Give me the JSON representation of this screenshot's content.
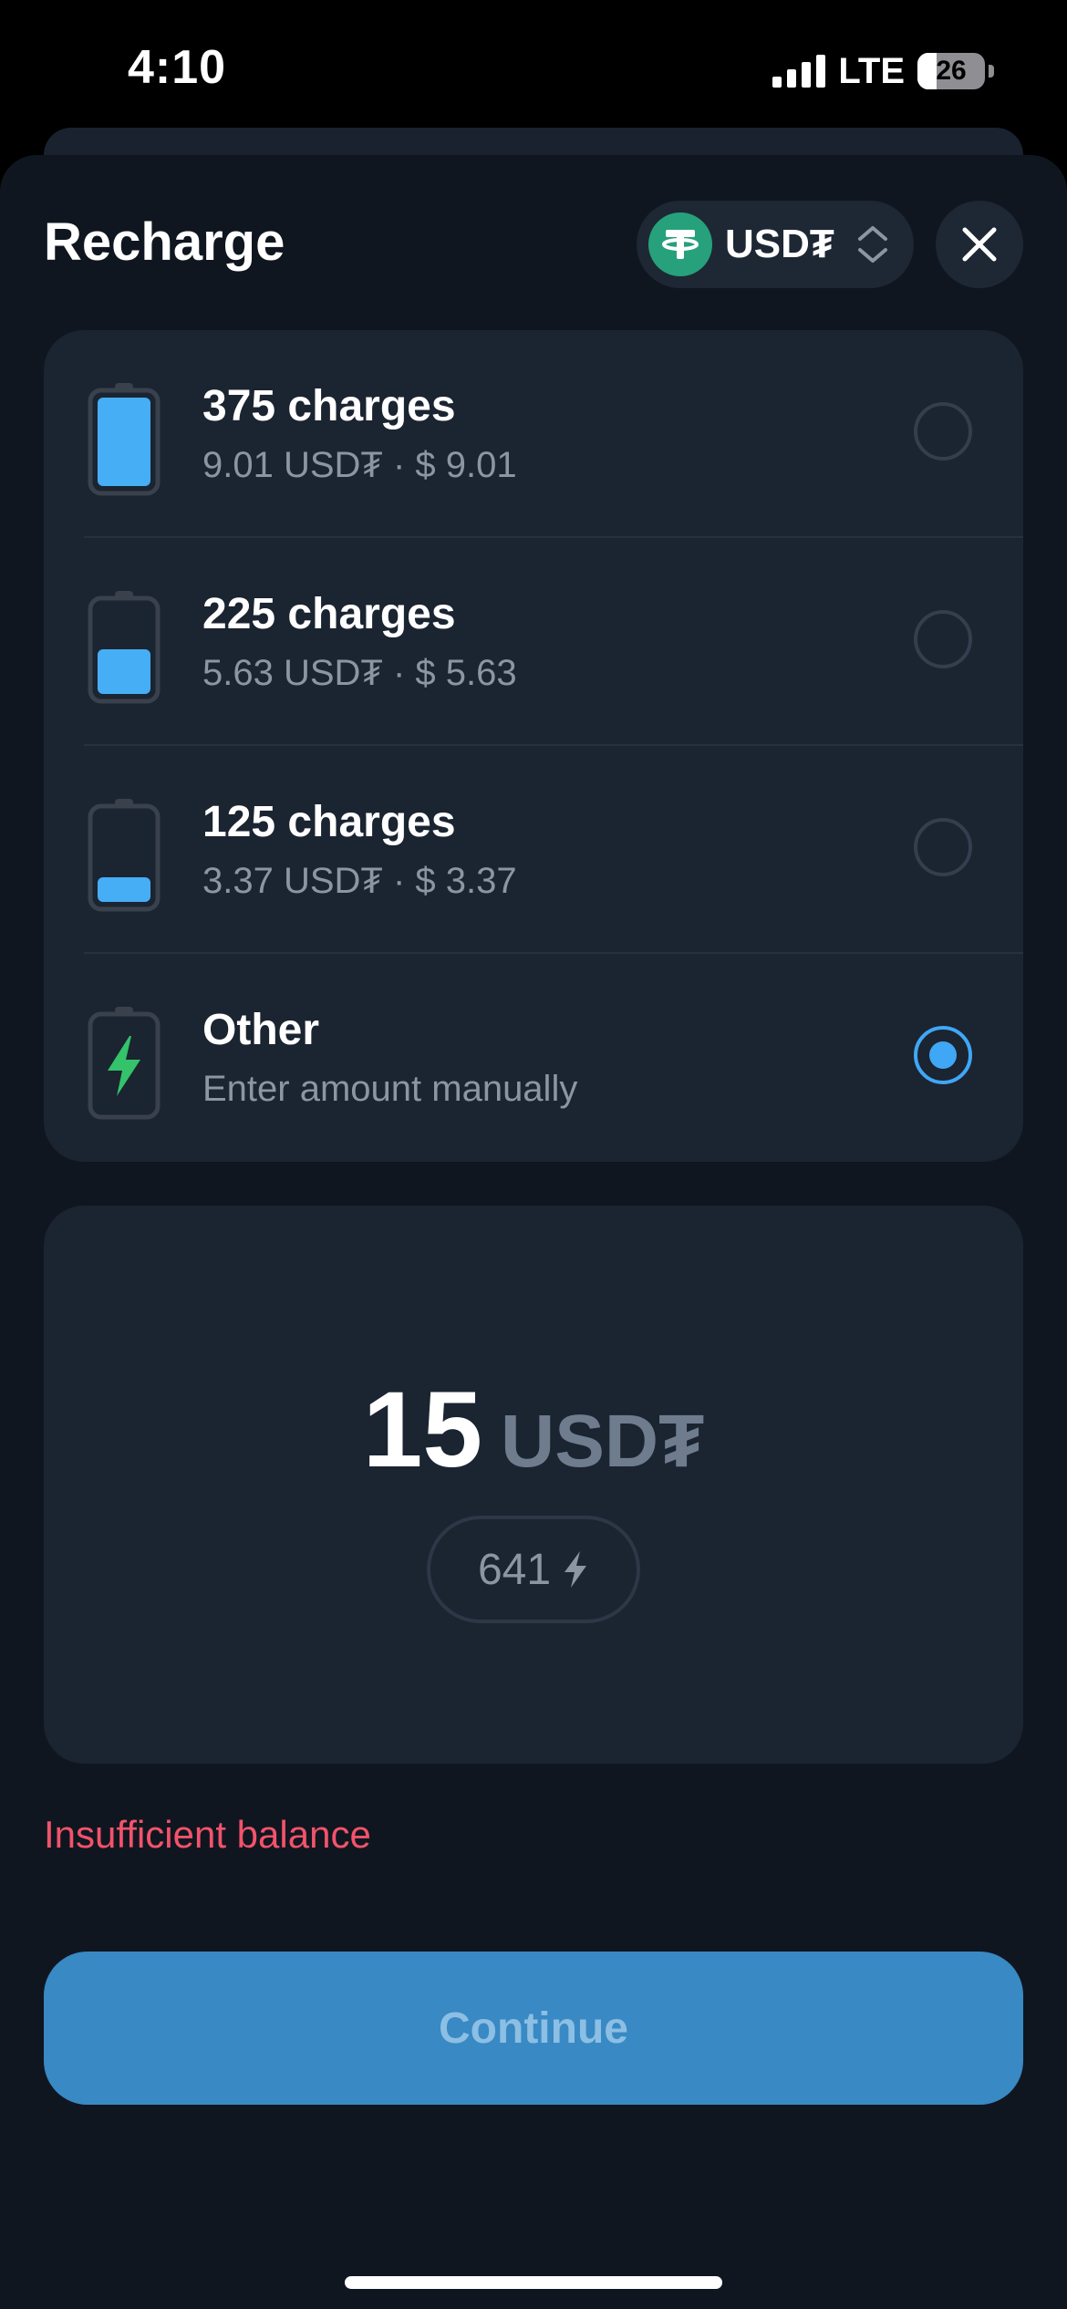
{
  "status_bar": {
    "time": "4:10",
    "network": "LTE",
    "battery": "26"
  },
  "sheet": {
    "title": "Recharge",
    "currency": {
      "label": "USD₮",
      "icon": "tether-icon"
    },
    "close_icon": "close-icon"
  },
  "options": [
    {
      "title": "375 charges",
      "subtitle": "9.01 USD₮ · $ 9.01",
      "fill": 1.0,
      "selected": false
    },
    {
      "title": "225 charges",
      "subtitle": "5.63 USD₮ · $ 5.63",
      "fill": 0.5,
      "selected": false
    },
    {
      "title": "125 charges",
      "subtitle": "3.37 USD₮ · $ 3.37",
      "fill": 0.25,
      "selected": false
    },
    {
      "title": "Other",
      "subtitle": "Enter amount manually",
      "fill": 0,
      "selected": true
    }
  ],
  "amount": {
    "value": "15",
    "unit": "USD₮",
    "charges": "641"
  },
  "error": "Insufficient balance",
  "continue_label": "Continue",
  "colors": {
    "accent": "#3fa7f5",
    "error": "#f2536b",
    "bolt": "#34c26a",
    "button": "#3889c4"
  }
}
